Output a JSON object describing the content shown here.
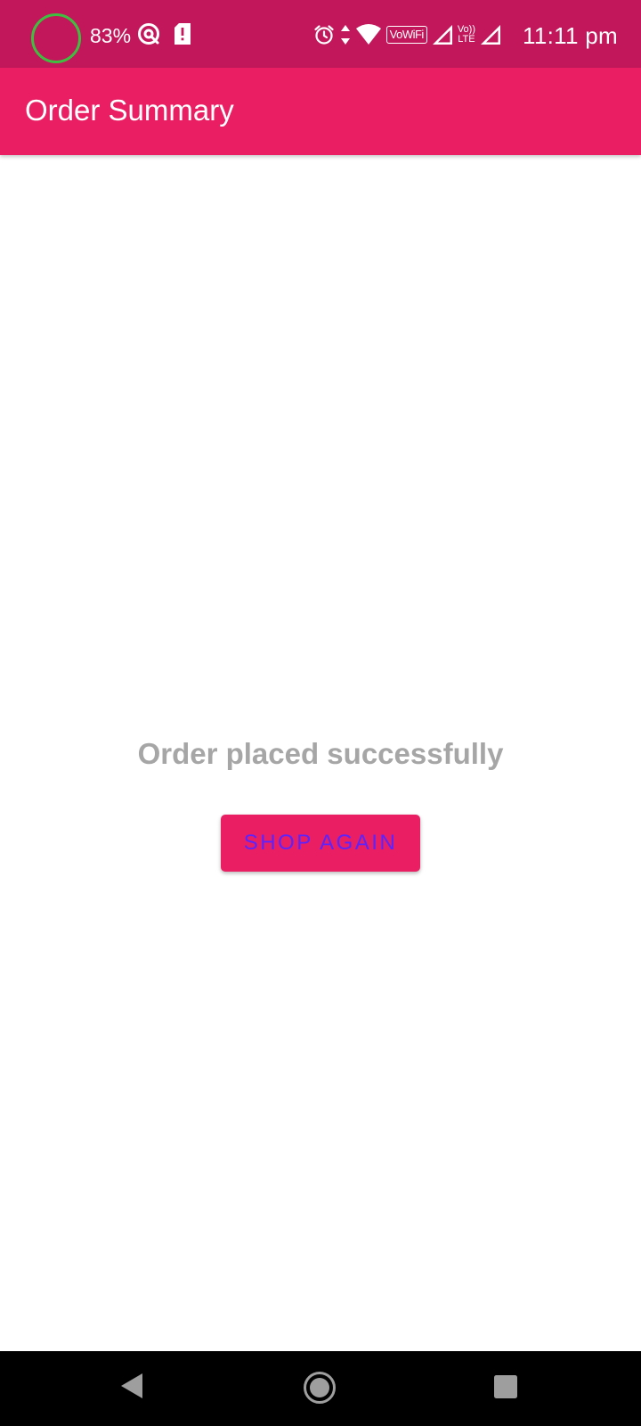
{
  "status_bar": {
    "battery_percent": "83%",
    "time": "11:11 pm",
    "vowifi_label": "VoWiFi",
    "volte_top": "Vo))",
    "volte_bottom": "LTE",
    "icons": [
      "battery-ring-icon",
      "sync-icon",
      "sim-alert-icon",
      "alarm-icon",
      "data-arrows-icon",
      "wifi-icon",
      "vowifi-badge",
      "signal-icon",
      "volte-badge",
      "signal-icon"
    ]
  },
  "app_bar": {
    "title": "Order Summary"
  },
  "main": {
    "message": "Order placed successfully",
    "button_label": "SHOP AGAIN"
  },
  "nav_bar": {
    "icons": [
      "back-icon",
      "home-icon",
      "recents-icon"
    ]
  },
  "colors": {
    "status_bar": "#c2185b",
    "app_bar": "#e91e63",
    "button_bg": "#e91e63",
    "button_text": "#5b24ff",
    "message_text": "#a6a6a6",
    "battery_ring": "#3fbf3f"
  }
}
